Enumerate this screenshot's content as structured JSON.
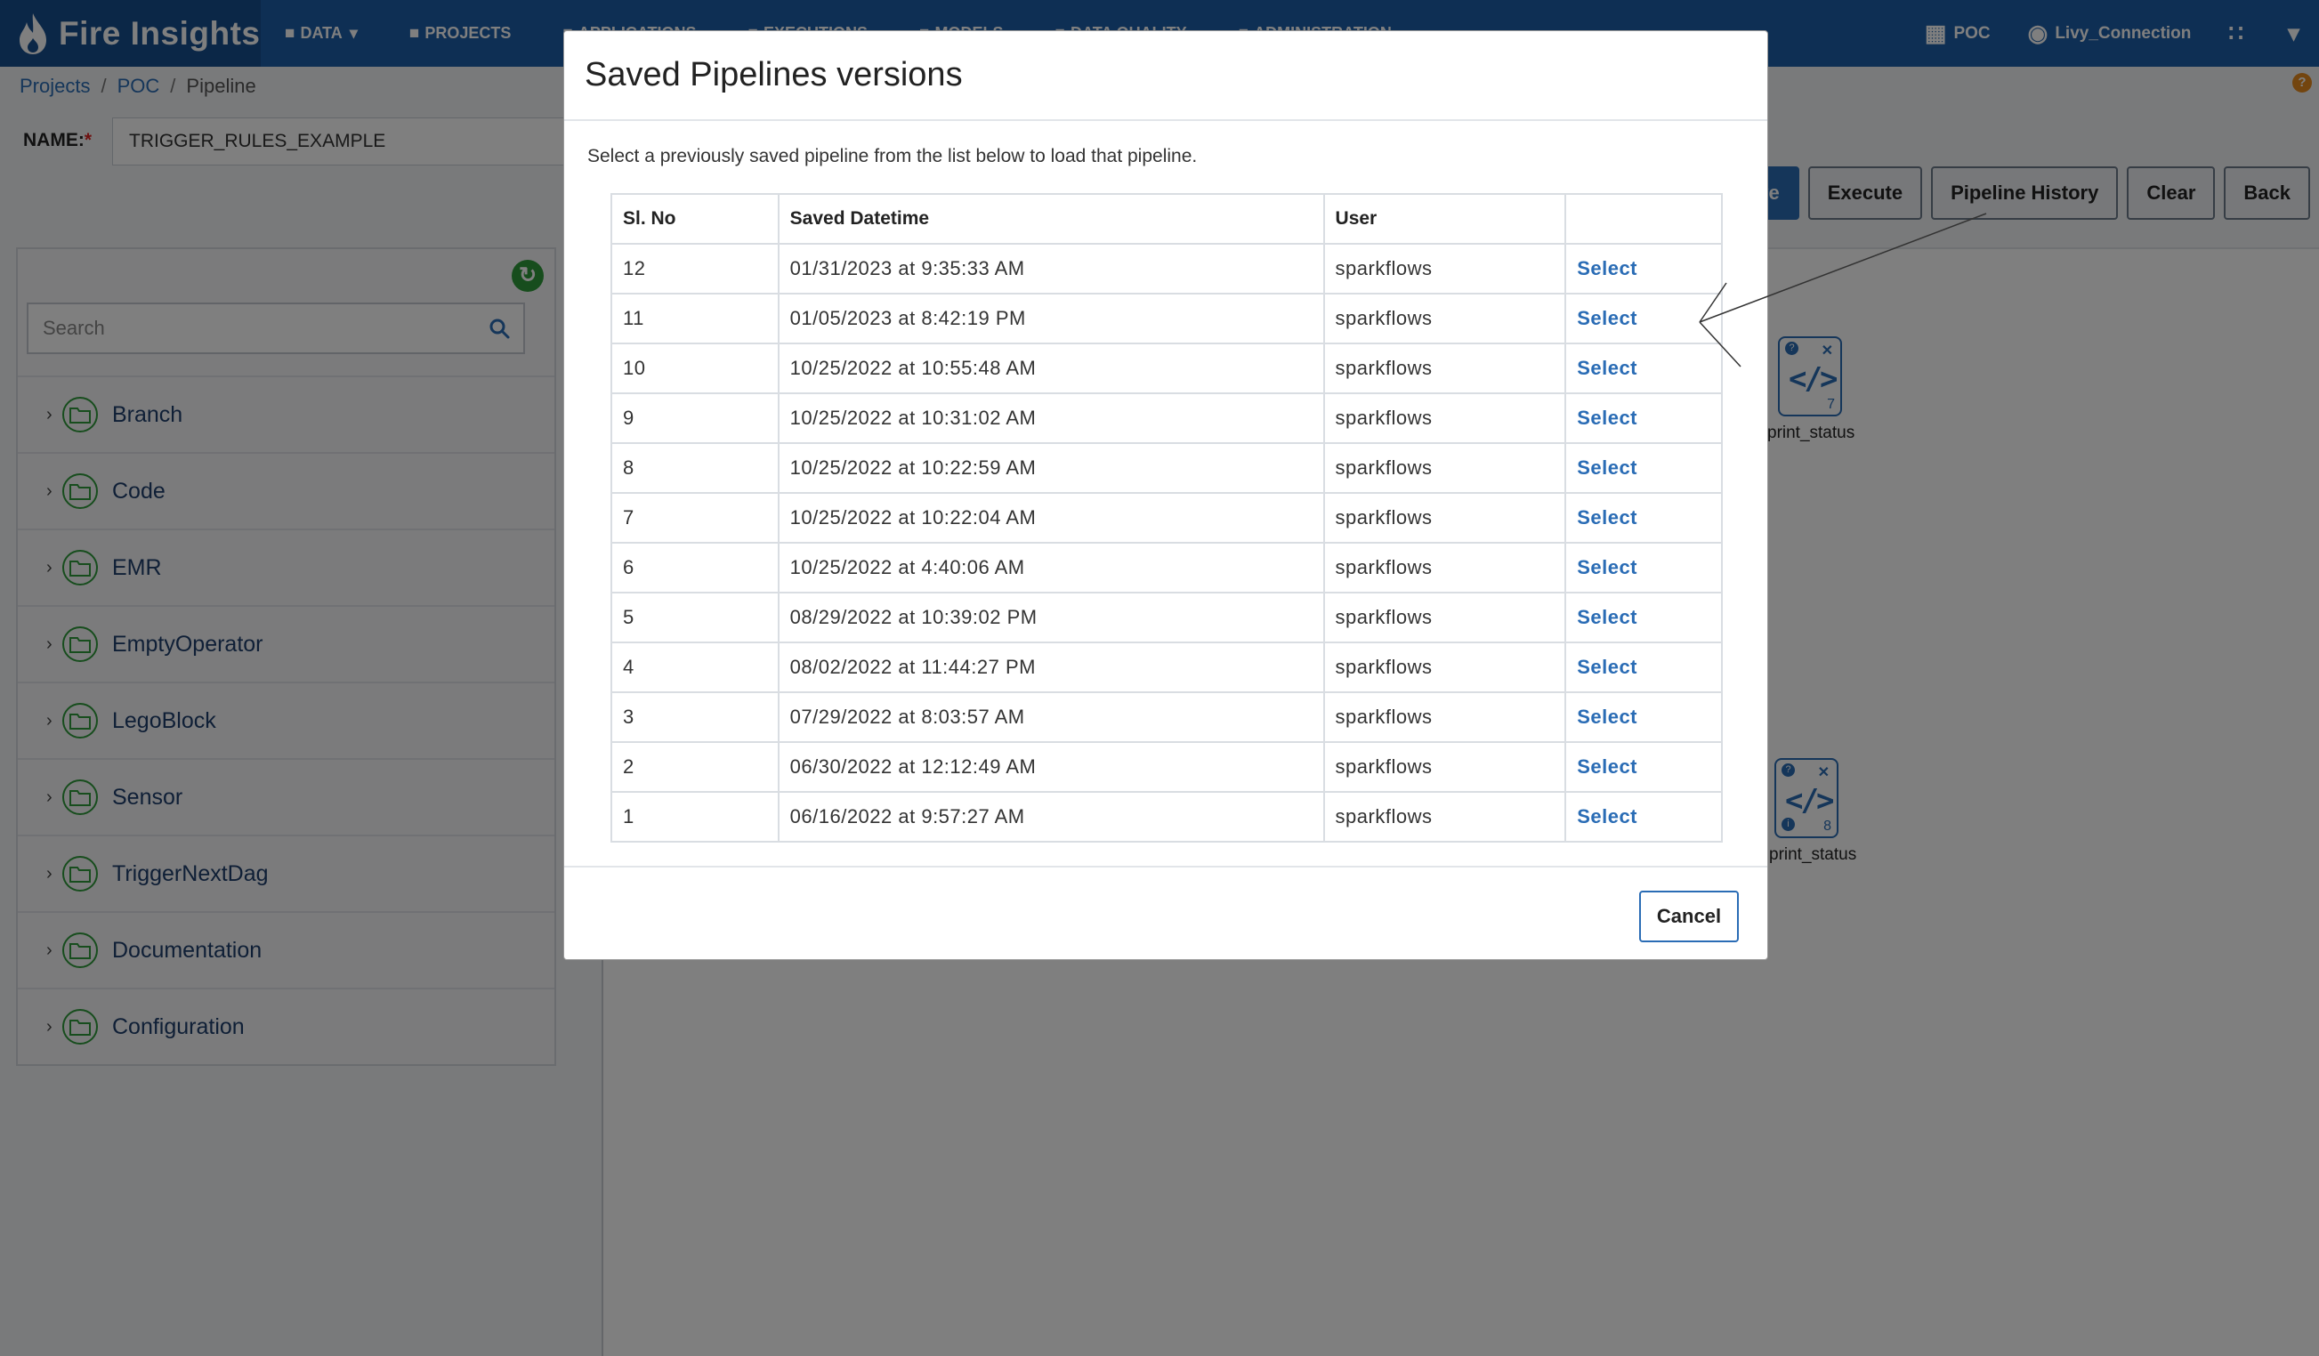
{
  "app": {
    "brand": "Fire Insights"
  },
  "topnav": {
    "items": [
      {
        "icon": "file-icon",
        "label": "DATA",
        "has_caret": true
      },
      {
        "icon": "grid-icon",
        "label": "PROJECTS"
      },
      {
        "icon": "apps-icon",
        "label": "APPLICATIONS"
      },
      {
        "icon": "run-icon",
        "label": "EXECUTIONS"
      },
      {
        "icon": "model-icon",
        "label": "MODELS"
      },
      {
        "icon": "quality-icon",
        "label": "DATA QUALITY"
      },
      {
        "icon": "admin-icon",
        "label": "ADMINISTRATION"
      }
    ],
    "right": {
      "project": "POC",
      "connection": "Livy_Connection"
    }
  },
  "breadcrumb": [
    "Projects",
    "POC",
    "Pipeline"
  ],
  "form": {
    "name_label": "NAME:",
    "required_mark": "*",
    "name_value": "TRIGGER_RULES_EXAMPLE"
  },
  "actions": {
    "save": "Save",
    "execute": "Execute",
    "history": "Pipeline History",
    "clear": "Clear",
    "back": "Back"
  },
  "sidebar": {
    "search_placeholder": "Search",
    "items": [
      {
        "label": "Branch"
      },
      {
        "label": "Code"
      },
      {
        "label": "EMR"
      },
      {
        "label": "EmptyOperator"
      },
      {
        "label": "LegoBlock"
      },
      {
        "label": "Sensor"
      },
      {
        "label": "TriggerNextDag"
      },
      {
        "label": "Documentation"
      },
      {
        "label": "Configuration"
      }
    ]
  },
  "canvas": {
    "nodes": [
      {
        "label": "print_status",
        "num": "7"
      },
      {
        "label": "print_status",
        "num": "8"
      }
    ]
  },
  "modal": {
    "title": "Saved Pipelines versions",
    "description": "Select a previously saved pipeline from the list below to load that pipeline.",
    "columns": [
      "Sl. No",
      "Saved Datetime",
      "User",
      ""
    ],
    "rows": [
      {
        "sl": "12",
        "datetime": "01/31/2023 at 9:35:33 AM",
        "user": "sparkflows",
        "action": "Select"
      },
      {
        "sl": "11",
        "datetime": "01/05/2023 at 8:42:19 PM",
        "user": "sparkflows",
        "action": "Select"
      },
      {
        "sl": "10",
        "datetime": "10/25/2022 at 10:55:48 AM",
        "user": "sparkflows",
        "action": "Select"
      },
      {
        "sl": "9",
        "datetime": "10/25/2022 at 10:31:02 AM",
        "user": "sparkflows",
        "action": "Select"
      },
      {
        "sl": "8",
        "datetime": "10/25/2022 at 10:22:59 AM",
        "user": "sparkflows",
        "action": "Select"
      },
      {
        "sl": "7",
        "datetime": "10/25/2022 at 10:22:04 AM",
        "user": "sparkflows",
        "action": "Select"
      },
      {
        "sl": "6",
        "datetime": "10/25/2022 at 4:40:06 AM",
        "user": "sparkflows",
        "action": "Select"
      },
      {
        "sl": "5",
        "datetime": "08/29/2022 at 10:39:02 PM",
        "user": "sparkflows",
        "action": "Select"
      },
      {
        "sl": "4",
        "datetime": "08/02/2022 at 11:44:27 PM",
        "user": "sparkflows",
        "action": "Select"
      },
      {
        "sl": "3",
        "datetime": "07/29/2022 at 8:03:57 AM",
        "user": "sparkflows",
        "action": "Select"
      },
      {
        "sl": "2",
        "datetime": "06/30/2022 at 12:12:49 AM",
        "user": "sparkflows",
        "action": "Select"
      },
      {
        "sl": "1",
        "datetime": "06/16/2022 at 9:57:27 AM",
        "user": "sparkflows",
        "action": "Select"
      }
    ],
    "cancel": "Cancel"
  },
  "colors": {
    "nav": "#1d5fa8",
    "brand_bg": "#174f8f",
    "accent": "#2a6cb5",
    "folder": "#2e9a3a",
    "help": "#e68a1e"
  }
}
